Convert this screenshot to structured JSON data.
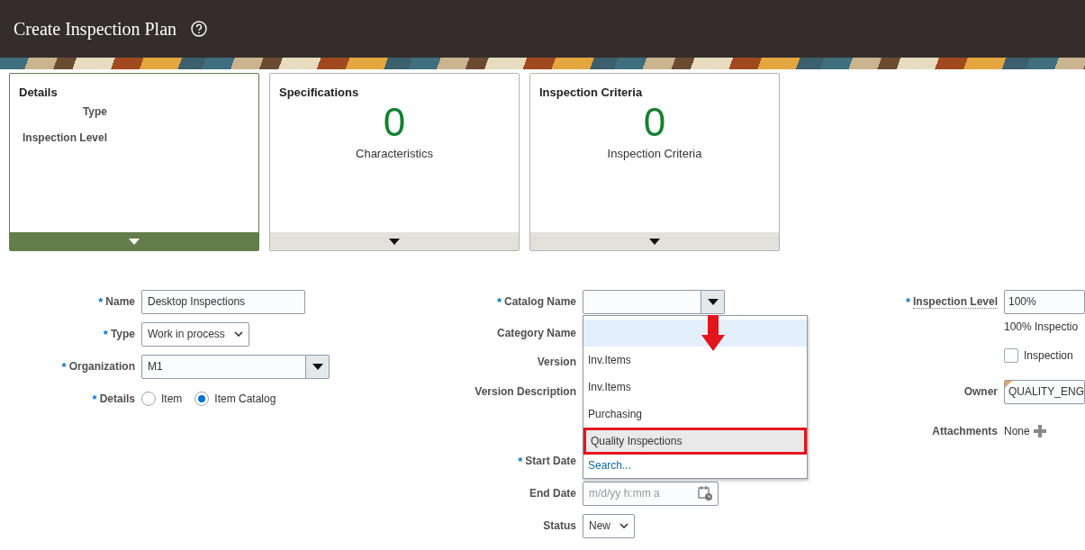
{
  "header": {
    "title": "Create Inspection Plan"
  },
  "cards": [
    {
      "kind": "details",
      "title": "Details",
      "selected": true,
      "labels": [
        "Type",
        "Inspection Level"
      ]
    },
    {
      "kind": "count",
      "title": "Specifications",
      "selected": false,
      "count": "0",
      "caption": "Characteristics"
    },
    {
      "kind": "count",
      "title": "Inspection Criteria",
      "selected": false,
      "count": "0",
      "caption": "Inspection Criteria"
    }
  ],
  "form": {
    "required_mark": "*",
    "columns": [
      [
        {
          "kind": "text",
          "label": "Name",
          "required": true,
          "value": "Desktop Inspections"
        },
        {
          "kind": "select",
          "label": "Type",
          "required": true,
          "value": "Work in process"
        },
        {
          "kind": "combobox",
          "label": "Organization",
          "required": true,
          "value": "M1"
        },
        {
          "kind": "radio",
          "label": "Details",
          "required": true,
          "options": [
            {
              "label": "Item",
              "selected": false
            },
            {
              "label": "Item Catalog",
              "selected": true
            }
          ]
        }
      ],
      [
        {
          "kind": "combobox",
          "label": "Catalog Name",
          "required": true
        },
        {
          "kind": "label",
          "label": "Category Name",
          "required": false
        },
        {
          "kind": "label",
          "label": "Version",
          "required": false
        },
        {
          "kind": "label",
          "label": "Version Description",
          "required": false
        },
        {
          "kind": "label",
          "label": "Start Date",
          "required": true
        },
        {
          "kind": "date",
          "label": "End Date",
          "required": false,
          "placeholder": "m/d/yy h:mm a"
        },
        {
          "kind": "select",
          "label": "Status",
          "required": false,
          "value": "New"
        }
      ],
      [
        {
          "kind": "text",
          "label": "Inspection Level",
          "required": true,
          "value": "100%"
        },
        {
          "kind": "note",
          "text": "100% Inspectio"
        },
        {
          "kind": "checkbox",
          "label": "Inspection",
          "checked": false
        },
        {
          "kind": "text",
          "label": "Owner",
          "required": false,
          "value": "QUALITY_ENG",
          "changed": true
        },
        {
          "kind": "attachments",
          "label": "Attachments",
          "required": false,
          "value": "None"
        }
      ]
    ]
  },
  "catalog_dropdown": {
    "items": [
      {
        "kind": "blank",
        "selected": true
      },
      {
        "kind": "option",
        "label": "Inv.Items",
        "selected": false,
        "outlined": false
      },
      {
        "kind": "option",
        "label": "Inv.Items",
        "selected": false,
        "outlined": false
      },
      {
        "kind": "option",
        "label": "Purchasing",
        "selected": false,
        "outlined": false
      },
      {
        "kind": "option",
        "label": "Quality Inspections",
        "selected": false,
        "outlined": true
      },
      {
        "kind": "link",
        "label": "Search..."
      }
    ]
  }
}
